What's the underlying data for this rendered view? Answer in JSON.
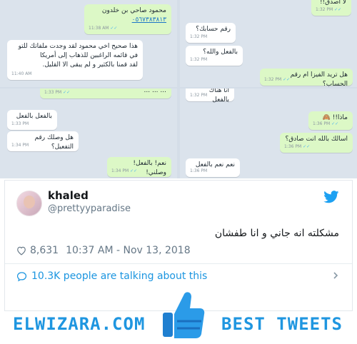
{
  "chat_top_left": {
    "msg1": {
      "line1": "محمود صاحي بن خلدون",
      "line2": "٠٥٦٧٣٨٣٨١٣",
      "time": "11:38 AM"
    },
    "msg2": {
      "lines": [
        "هذا صحيح اخي محمود لقد وجدت ملفاتك للتو",
        "في قائمه الراغبين للذهاب إلى أمريكا",
        "لقد قمنا بالكثير و لم يبقى الا القليل."
      ],
      "time": "11:40 AM"
    },
    "msg3": {
      "text": "... ... ...",
      "time": "1:33 PM"
    }
  },
  "chat_top_right": {
    "msg1": {
      "text": "لا أصدق!!",
      "time": "1:32 PM"
    },
    "msg2": {
      "text": "رقم حسابك؟",
      "time": "1:32 PM"
    },
    "msg3": {
      "text": "بالفعل والله؟",
      "time": "1:32 PM"
    },
    "msg4": {
      "text": "هل تريد الفيزا ام رقم الحساب؟",
      "time": "1:32 PM"
    },
    "msg5": {
      "text": "انا هناك بالفعل",
      "time": "1:32 PM"
    }
  },
  "chat_bottom_left": {
    "msg1": {
      "text": "بالفعل بالفعل",
      "time": "1:33 PM"
    },
    "msg2": {
      "text": "هل وصلك رقم التفعيل؟",
      "time": "1:34 PM"
    },
    "msg3": {
      "text": "نعم! بالفعل! وصلني!",
      "time": "1:34 PM"
    }
  },
  "chat_bottom_right": {
    "msg1": {
      "text": "ماذا!! 🙈",
      "time": "1:36 PM"
    },
    "msg2": {
      "text": "اسالك بالله انت صادق؟",
      "time": "1:36 PM"
    },
    "msg3": {
      "text": "نعم نعم بالفعل",
      "time": "1:36 PM"
    }
  },
  "tweet": {
    "name": "khaled",
    "handle": "@prettyyparadise",
    "text": "مشكلته انه جاني و انا طفشان",
    "likes": "8,631",
    "timestamp": "10:37 AM - Nov 13, 2018",
    "talking": "10.3K people are talking about this"
  },
  "footer": {
    "brand": "ELWIZARA.COM",
    "label": "BEST TWEETS"
  },
  "colors": {
    "twitter_blue": "#1da1f2",
    "brand_blue": "#1f96e0",
    "outgoing_bubble": "#dcf8c6"
  }
}
